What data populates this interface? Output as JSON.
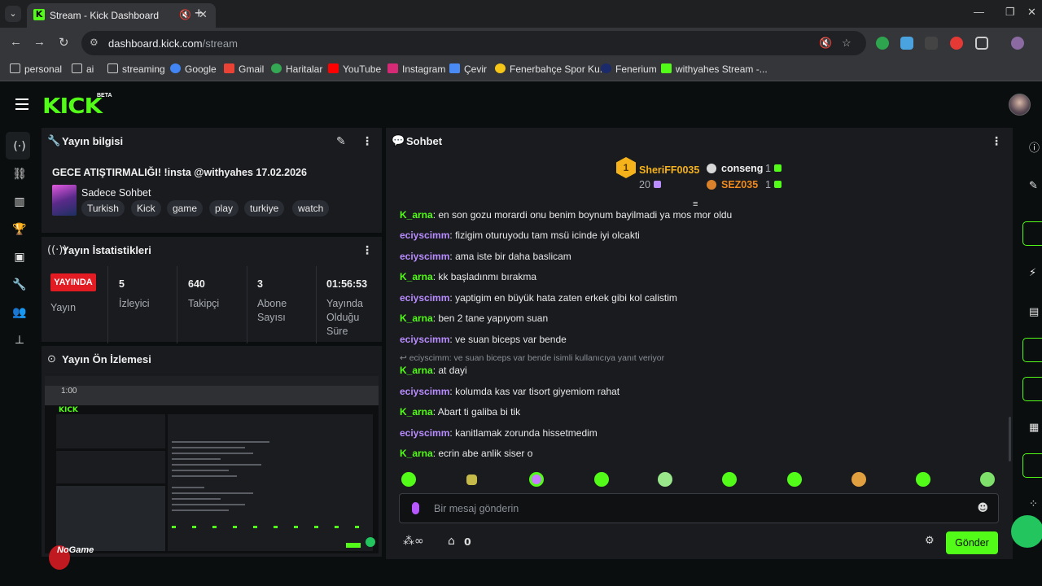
{
  "browser": {
    "tab_title": "Stream - Kick Dashboard",
    "url_host": "dashboard.kick.com",
    "url_path": "/stream",
    "bookmarks": [
      "personal",
      "ai",
      "streaming",
      "Google",
      "Gmail",
      "Haritalar",
      "YouTube",
      "Instagram",
      "Çevir",
      "Fenerbahçe Spor Ku...",
      "Fenerium",
      "withyahes Stream -..."
    ]
  },
  "header": {
    "logo": "KICK",
    "beta": "BETA"
  },
  "stream_info": {
    "title": "Yayın bilgisi",
    "stream_title": "GECE ATIŞTIRMALIĞI! !insta @withyahes 17.02.2026",
    "category": "Sadece Sohbet",
    "tags": [
      "Turkish",
      "Kick",
      "game",
      "play",
      "turkiye",
      "watch"
    ]
  },
  "stats": {
    "title": "Yayın İstatistikleri",
    "live_badge": "YAYINDA",
    "status_label": "Yayın",
    "viewers_value": "5",
    "viewers_label": "İzleyici",
    "followers_value": "640",
    "followers_label": "Takipçi",
    "subs_value": "3",
    "subs_label": "Abone Sayısı",
    "uptime_value": "01:56:53",
    "uptime_label": "Yayında Olduğu Süre"
  },
  "preview": {
    "title": "Yayın Ön İzlemesi",
    "overlay_text": "NoGame",
    "time_overlay": "1:00"
  },
  "chat": {
    "title": "Sohbet",
    "top_gifters": [
      {
        "rank": "1",
        "name": "SheriFF0035",
        "count": "20",
        "color": "#f5b21a"
      },
      {
        "rank": "2",
        "name": "conseng",
        "count": "1",
        "color": "#f0f0f0"
      },
      {
        "rank": "3",
        "name": "SEZ035",
        "count": "1",
        "color": "#f08a1a"
      }
    ],
    "messages": [
      {
        "user": "K_arna",
        "text": "en son gozu morardi onu benim boynum bayilmadi ya mos mor oldu",
        "color": "#53fc18"
      },
      {
        "user": "eciyscimm",
        "text": "fizigim oturuyodu tam msü icinde iyi olcakti",
        "color": "#b98cff"
      },
      {
        "user": "eciyscimm",
        "text": "ama iste bir daha baslicam",
        "color": "#b98cff"
      },
      {
        "user": "K_arna",
        "text": "kk başladınmı bırakma",
        "color": "#53fc18"
      },
      {
        "user": "eciyscimm",
        "text": "yaptigim en büyük hata zaten erkek gibi kol calistim",
        "color": "#b98cff"
      },
      {
        "user": "K_arna",
        "text": "ben 2 tane yapıyom suan",
        "color": "#53fc18"
      },
      {
        "user": "eciyscimm",
        "text": "ve suan biceps var bende",
        "color": "#b98cff"
      },
      {
        "user": "K_arna",
        "text": "at dayi",
        "color": "#53fc18"
      },
      {
        "user": "eciyscimm",
        "text": "kolumda kas var tisort giyemiom rahat",
        "color": "#b98cff"
      },
      {
        "user": "K_arna",
        "text": "Abart ti galiba bi tik",
        "color": "#53fc18"
      },
      {
        "user": "eciyscimm",
        "text": "kanitlamak zorunda hissetmedim",
        "color": "#b98cff"
      },
      {
        "user": "K_arna",
        "text": "ecrin abe anlik siser o",
        "color": "#53fc18"
      }
    ],
    "reply_note": "eciyscimm: ve suan biceps var bende isimli kullanıcıya yanıt veriyor",
    "input_placeholder": "Bir mesaj gönderin",
    "points_value": "0",
    "send_label": "Gönder"
  },
  "colors": {
    "brand": "#53fc18",
    "live": "#e31b23",
    "panel": "#191b1f"
  }
}
